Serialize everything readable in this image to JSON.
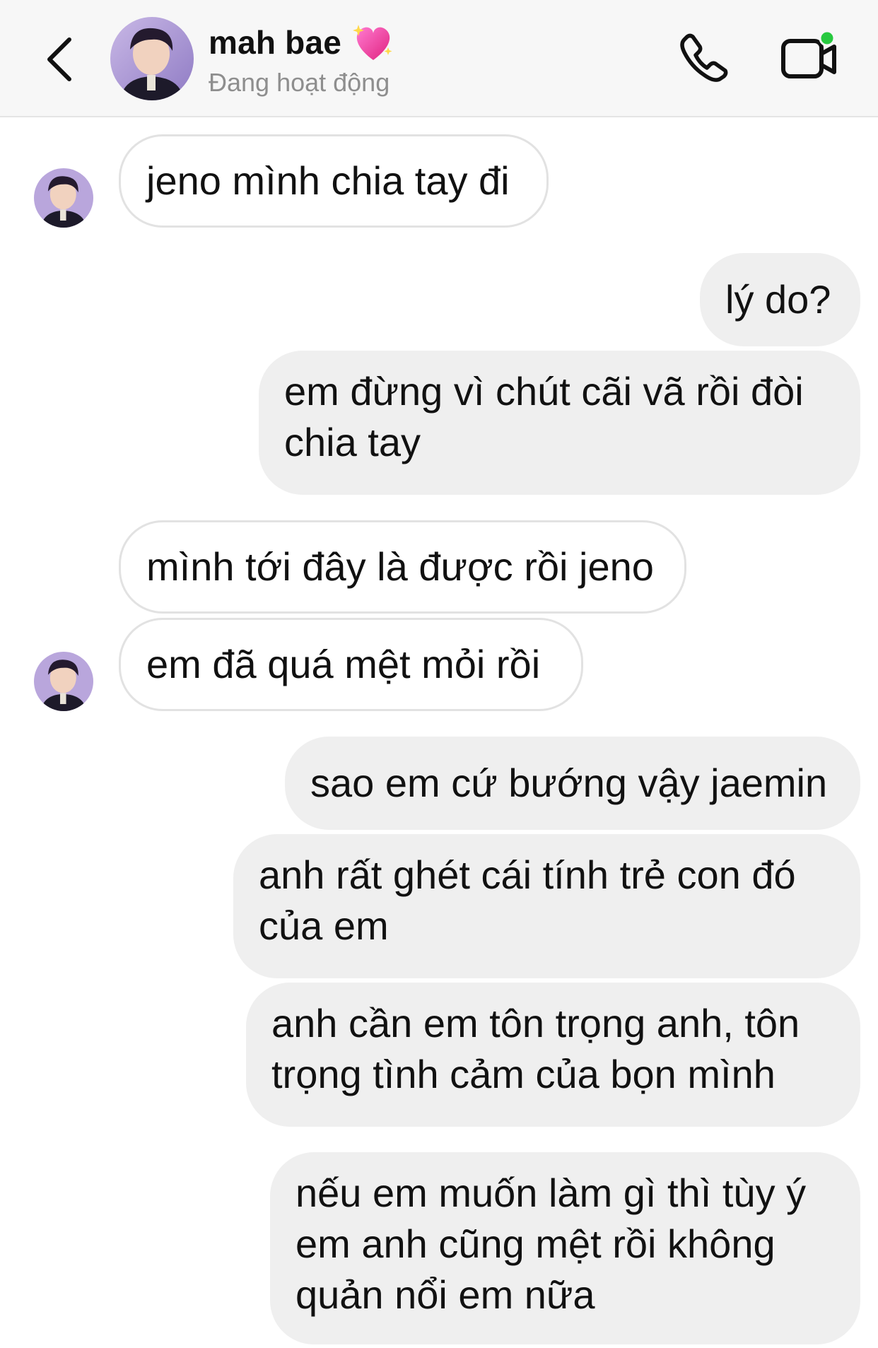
{
  "header": {
    "name": "mah bae",
    "status": "Đang hoạt động",
    "name_emoji_icon": "sparkling-heart-icon",
    "back_icon": "chevron-left-icon",
    "call_icon": "phone-icon",
    "video_icon": "video-camera-icon",
    "active_dot_color": "#27c93f"
  },
  "messages": [
    {
      "dir": "in",
      "text": "jeno mình chia tay đi"
    },
    {
      "dir": "out",
      "text": "lý do?"
    },
    {
      "dir": "out",
      "text": "em đừng vì chút cãi vã rồi đòi\nchia tay"
    },
    {
      "dir": "in",
      "text": "mình tới đây là được rồi jeno"
    },
    {
      "dir": "in",
      "text": "em đã quá mệt mỏi rồi"
    },
    {
      "dir": "out",
      "text": "sao em cứ bướng vậy jaemin"
    },
    {
      "dir": "out",
      "text": "anh rất ghét cái tính trẻ con đó\ncủa em"
    },
    {
      "dir": "out",
      "text": "anh cần em tôn trọng anh, tôn\ntrọng tình cảm của bọn mình"
    },
    {
      "dir": "out",
      "text": "nếu em muốn làm gì thì tùy ý\nem anh cũng mệt rồi không\nquản nổi em nữa"
    }
  ],
  "colors": {
    "incoming_bubble": "#ffffff",
    "incoming_border": "#e2e2e2",
    "outgoing_bubble": "#efefef",
    "header_bg": "#f7f7f7",
    "status_text": "#8e8e8e"
  }
}
